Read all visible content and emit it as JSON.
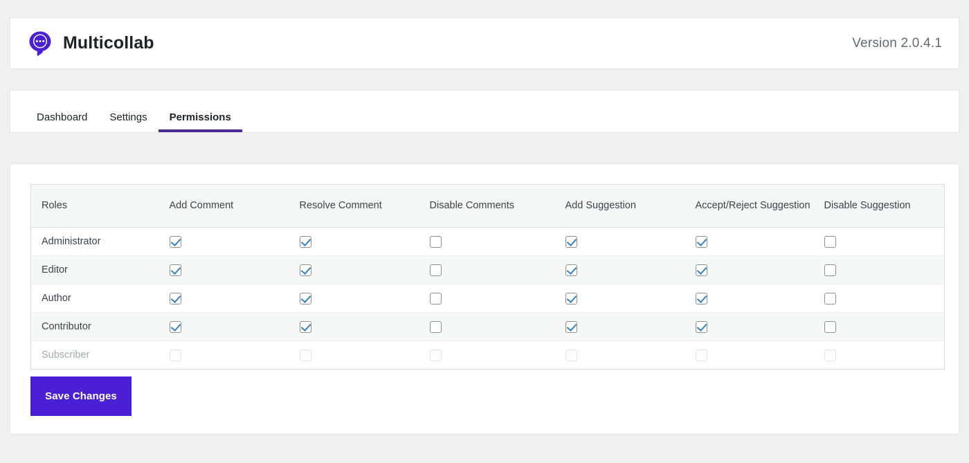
{
  "header": {
    "brand_name": "Multicollab",
    "logo_icon": "chat-bubble-pin-icon",
    "version_label": "Version 2.0.4.1"
  },
  "tabs": [
    {
      "label": "Dashboard",
      "active": false
    },
    {
      "label": "Settings",
      "active": false
    },
    {
      "label": "Permissions",
      "active": true
    }
  ],
  "permissions_table": {
    "columns": [
      "Roles",
      "Add Comment",
      "Resolve Comment",
      "Disable Comments",
      "Add Suggestion",
      "Accept/Reject Suggestion",
      "Disable Suggestion"
    ],
    "rows": [
      {
        "role": "Administrator",
        "disabled": false,
        "values": [
          true,
          true,
          false,
          true,
          true,
          false
        ]
      },
      {
        "role": "Editor",
        "disabled": false,
        "values": [
          true,
          true,
          false,
          true,
          true,
          false
        ]
      },
      {
        "role": "Author",
        "disabled": false,
        "values": [
          true,
          true,
          false,
          true,
          true,
          false
        ]
      },
      {
        "role": "Contributor",
        "disabled": false,
        "values": [
          true,
          true,
          false,
          true,
          true,
          false
        ]
      },
      {
        "role": "Subscriber",
        "disabled": true,
        "values": [
          false,
          false,
          false,
          false,
          false,
          false
        ]
      }
    ]
  },
  "actions": {
    "save_label": "Save Changes"
  },
  "colors": {
    "brand_purple": "#4b1fd4",
    "tab_underline": "#4a2a95",
    "checkbox_check": "#3582c4",
    "page_background": "#f0f0f1",
    "header_text": "#1d2327",
    "muted_text": "#646970"
  }
}
